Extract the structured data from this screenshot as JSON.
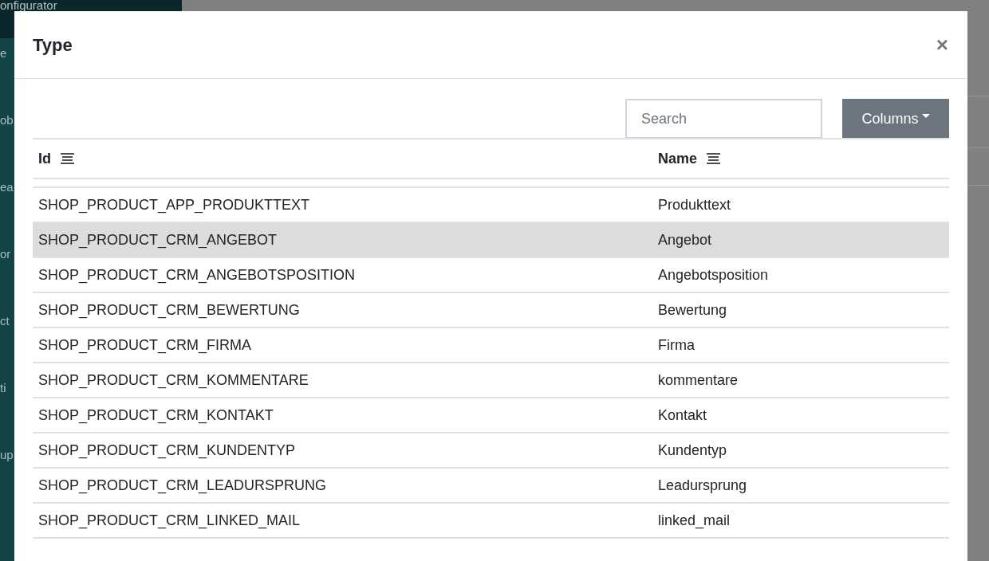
{
  "sidebar": {
    "header": "onfigurator",
    "items": [
      "e",
      "ob",
      "ea",
      "or",
      "ct",
      "ti",
      "up"
    ]
  },
  "modal": {
    "title": "Type",
    "close": "×",
    "search": {
      "placeholder": "Search"
    },
    "columns_button": "Columns",
    "table": {
      "columns": [
        "Id",
        "Name"
      ],
      "rows": [
        {
          "id": "SHOP_PRODUCT_APP_PRODUKTTEXT",
          "name": "Produkttext",
          "selected": false
        },
        {
          "id": "SHOP_PRODUCT_CRM_ANGEBOT",
          "name": "Angebot",
          "selected": true
        },
        {
          "id": "SHOP_PRODUCT_CRM_ANGEBOTSPOSITION",
          "name": "Angebotsposition",
          "selected": false
        },
        {
          "id": "SHOP_PRODUCT_CRM_BEWERTUNG",
          "name": "Bewertung",
          "selected": false
        },
        {
          "id": "SHOP_PRODUCT_CRM_FIRMA",
          "name": "Firma",
          "selected": false
        },
        {
          "id": "SHOP_PRODUCT_CRM_KOMMENTARE",
          "name": "kommentare",
          "selected": false
        },
        {
          "id": "SHOP_PRODUCT_CRM_KONTAKT",
          "name": "Kontakt",
          "selected": false
        },
        {
          "id": "SHOP_PRODUCT_CRM_KUNDENTYP",
          "name": "Kundentyp",
          "selected": false
        },
        {
          "id": "SHOP_PRODUCT_CRM_LEADURSPRUNG",
          "name": "Leadursprung",
          "selected": false
        },
        {
          "id": "SHOP_PRODUCT_CRM_LINKED_MAIL",
          "name": "linked_mail",
          "selected": false
        }
      ]
    }
  }
}
